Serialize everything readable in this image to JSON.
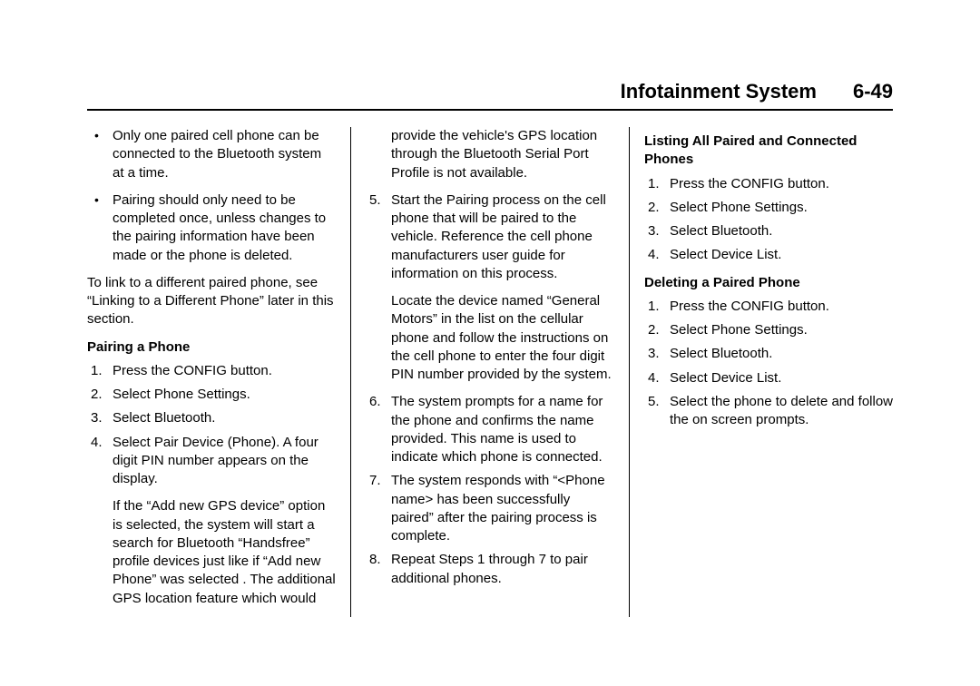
{
  "header": {
    "title": "Infotainment System",
    "page": "6-49"
  },
  "col1": {
    "bullets": [
      "Only one paired cell phone can be connected to the Bluetooth system at a time.",
      "Pairing should only need to be completed once, unless changes to the pairing information have been made or the phone is deleted."
    ],
    "linkPara": "To link to a different paired phone, see “Linking to a Different Phone” later in this section.",
    "pairingHeading": "Pairing a Phone",
    "pairingSteps": [
      "Press the CONFIG button.",
      "Select Phone Settings.",
      "Select Bluetooth.",
      "Select Pair Device (Phone). A four digit PIN number appears on the display."
    ],
    "pairingNote": "If the “Add new GPS device” option is selected, the system will start a search for Bluetooth “Handsfree” profile devices just like if “Add new Phone” was selected . The additional GPS location feature which would"
  },
  "col2": {
    "cont4": "provide the vehicle's GPS location through the Bluetooth Serial Port Profile is not available.",
    "step5": "Start the Pairing process on the cell phone that will be paired to the vehicle. Reference the cell phone manufacturers user guide for information on this process.",
    "step5b": "Locate the device named “General Motors” in the list on the cellular phone and follow the instructions on the cell phone to enter the four digit PIN number provided by the system.",
    "step6": "The system prompts for a name for the phone and confirms the name provided. This name is used to indicate which phone is connected.",
    "step7": "The system responds with “<Phone name> has been successfully paired” after the pairing process is complete.",
    "step8": "Repeat Steps 1 through 7 to pair additional phones."
  },
  "col3": {
    "listingHeading": "Listing All Paired and Connected Phones",
    "listingSteps": [
      "Press the CONFIG button.",
      "Select Phone Settings.",
      "Select Bluetooth.",
      "Select Device List."
    ],
    "deletingHeading": "Deleting a Paired Phone",
    "deletingSteps": [
      "Press the CONFIG button.",
      "Select Phone Settings.",
      "Select Bluetooth.",
      "Select Device List.",
      "Select the phone to delete and follow the on screen prompts."
    ]
  }
}
